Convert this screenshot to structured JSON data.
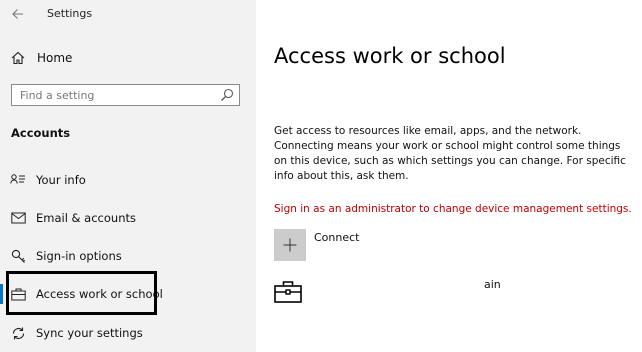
{
  "window": {
    "title": "Settings"
  },
  "sidebar": {
    "home_label": "Home",
    "search_placeholder": "Find a setting",
    "section_heading": "Accounts",
    "items": [
      {
        "label": "Your info",
        "icon": "person-card-icon"
      },
      {
        "label": "Email & accounts",
        "icon": "envelope-icon"
      },
      {
        "label": "Sign-in options",
        "icon": "key-icon"
      },
      {
        "label": "Access work or school",
        "icon": "briefcase-icon",
        "selected": true
      },
      {
        "label": "Sync your settings",
        "icon": "sync-icon"
      }
    ]
  },
  "main": {
    "title": "Access work or school",
    "description": "Get access to resources like email, apps, and the network. Connecting means your work or school might control some things on this device, such as which settings you can change. For specific info about this, ask them.",
    "admin_warning": "Sign in as an administrator to change device management settings.",
    "connect_label": "Connect",
    "account_label_partial": "ain"
  },
  "colors": {
    "sidebar_bg": "#f2f2f2",
    "accent": "#0078d7",
    "warning": "#c00000",
    "connect_tile": "#cccccc"
  }
}
